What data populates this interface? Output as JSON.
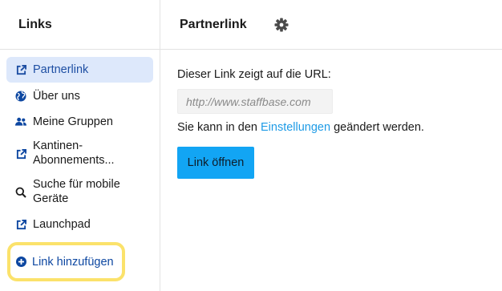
{
  "sidebar": {
    "title": "Links",
    "items": [
      {
        "label": "Partnerlink",
        "icon": "external-link-icon",
        "active": true
      },
      {
        "label": "Über uns",
        "icon": "globe-icon"
      },
      {
        "label": "Meine Gruppen",
        "icon": "group-icon"
      },
      {
        "label": "Kantinen-Abonnements...",
        "icon": "external-link-icon"
      },
      {
        "label": "Suche für mobile Geräte",
        "icon": "search-icon"
      },
      {
        "label": "Launchpad",
        "icon": "external-link-icon"
      }
    ],
    "add_link": {
      "label": "Link hinzufügen",
      "icon": "plus-circle-icon"
    }
  },
  "main": {
    "title": "Partnerlink",
    "settings_icon": "gear-icon",
    "description": "Dieser Link zeigt auf die URL:",
    "url_placeholder": "http://www.staffbase.com",
    "hint_prefix": "Sie kann in den",
    "hint_link": "Einstellungen",
    "hint_suffix": "geändert werden.",
    "open_button": "Link öffnen"
  },
  "colors": {
    "accent": "#12a5f4",
    "link": "#1e9be6",
    "active_bg": "#dde8fb",
    "active_text": "#1e4fa3",
    "highlight": "#fbe26b"
  }
}
